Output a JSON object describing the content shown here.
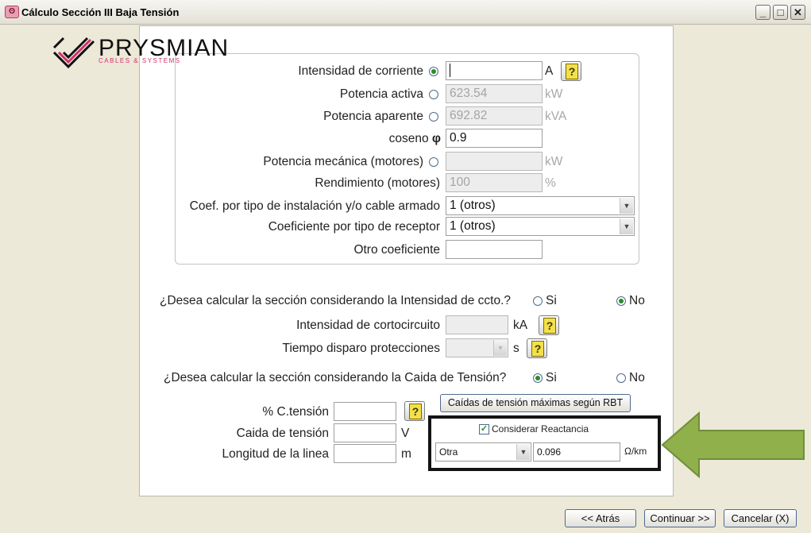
{
  "window": {
    "title": "Cálculo Sección III Baja Tensión"
  },
  "logo": {
    "brand": "PRYSMIAN",
    "tagline": "CABLES & SYSTEMS"
  },
  "form": {
    "intensidad": {
      "label": "Intensidad de corriente",
      "value": "",
      "unit": "A",
      "selected": true
    },
    "potencia_activa": {
      "label": "Potencia activa",
      "value": "623.54",
      "unit": "kW",
      "selected": false
    },
    "potencia_aparente": {
      "label": "Potencia aparente",
      "value": "692.82",
      "unit": "kVA",
      "selected": false
    },
    "coseno": {
      "label": "coseno",
      "symbol": "φ",
      "value": "0.9"
    },
    "potencia_mecanica": {
      "label": "Potencia mecánica (motores)",
      "value": "",
      "unit": "kW",
      "selected": false
    },
    "rendimiento": {
      "label": "Rendimiento (motores)",
      "value": "100",
      "unit": "%"
    },
    "coef_instalacion": {
      "label": "Coef. por tipo de instalación y/o cable armado",
      "value": "1 (otros)"
    },
    "coef_receptor": {
      "label": "Coeficiente por tipo de receptor",
      "value": "1 (otros)"
    },
    "otro_coef": {
      "label": "Otro coeficiente",
      "value": ""
    }
  },
  "cortocircuito": {
    "question": "¿Desea calcular la sección considerando la Intensidad de ccto.?",
    "yes_label": "Si",
    "no_label": "No",
    "selected": "No",
    "intensidad_label": "Intensidad de cortocircuito",
    "intensidad_unit": "kA",
    "tiempo_label": "Tiempo disparo protecciones",
    "tiempo_unit": "s"
  },
  "caida": {
    "question": "¿Desea calcular la sección considerando la Caida de Tensión?",
    "yes_label": "Si",
    "no_label": "No",
    "selected": "Si",
    "rbt_button": "Caídas de tensión máximas según RBT",
    "pct_label": "% C.tensión",
    "caida_label": "Caida de tensión",
    "caida_unit": "V",
    "longitud_label": "Longitud de la linea",
    "longitud_unit": "m",
    "reactancia_label": "Considerar Reactancia",
    "reactancia_checked": true,
    "reactancia_type": "Otra",
    "reactancia_value": "0.096",
    "reactancia_unit": "Ω/km"
  },
  "footer": {
    "back": "<< Atrás",
    "next": "Continuar >>",
    "cancel": "Cancelar (X)"
  },
  "colors": {
    "arrow_fill": "#8FB04A",
    "arrow_stroke": "#6F8E3A",
    "accent_green": "#2A8C2A"
  },
  "icons": [
    "app-icon",
    "help-icon",
    "minimize-icon",
    "maximize-icon",
    "close-icon",
    "chevron-down-icon",
    "arrow-left-icon",
    "check-icon"
  ]
}
